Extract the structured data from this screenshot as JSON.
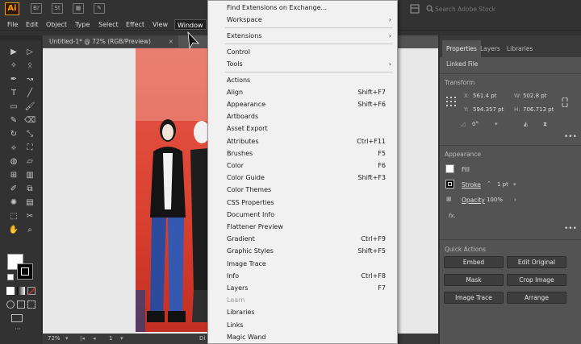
{
  "app": {
    "logo": "Ai",
    "icons": [
      {
        "name": "bridge-icon",
        "text": "Br"
      },
      {
        "name": "stock-icon",
        "text": "St"
      },
      {
        "name": "workspace-grid-icon",
        "text": "▦"
      },
      {
        "name": "brush-arrange-icon",
        "text": "✎"
      }
    ],
    "search_placeholder": "Search Adobe Stock"
  },
  "menubar": {
    "items": [
      "File",
      "Edit",
      "Object",
      "Type",
      "Select",
      "Effect",
      "View",
      "Window"
    ]
  },
  "document": {
    "tab_title": "Untitled-1* @ 72% (RGB/Preview)",
    "zoom": "72%",
    "page": "1",
    "status_text": "Di"
  },
  "window_menu": {
    "items": [
      {
        "label": "Find Extensions on Exchange...",
        "shortcut": "",
        "submenu": false,
        "disabled": false
      },
      {
        "label": "Workspace",
        "shortcut": "",
        "submenu": true,
        "disabled": false,
        "sep_after": true
      },
      {
        "label": "Extensions",
        "shortcut": "",
        "submenu": true,
        "disabled": false,
        "sep_after": true
      },
      {
        "label": "Control",
        "shortcut": "",
        "submenu": false,
        "disabled": false
      },
      {
        "label": "Tools",
        "shortcut": "",
        "submenu": true,
        "disabled": false,
        "sep_after": true
      },
      {
        "label": "Actions",
        "shortcut": "",
        "submenu": false,
        "disabled": false
      },
      {
        "label": "Align",
        "shortcut": "Shift+F7",
        "submenu": false,
        "disabled": false
      },
      {
        "label": "Appearance",
        "shortcut": "Shift+F6",
        "submenu": false,
        "disabled": false
      },
      {
        "label": "Artboards",
        "shortcut": "",
        "submenu": false,
        "disabled": false
      },
      {
        "label": "Asset Export",
        "shortcut": "",
        "submenu": false,
        "disabled": false
      },
      {
        "label": "Attributes",
        "shortcut": "Ctrl+F11",
        "submenu": false,
        "disabled": false
      },
      {
        "label": "Brushes",
        "shortcut": "F5",
        "submenu": false,
        "disabled": false
      },
      {
        "label": "Color",
        "shortcut": "F6",
        "submenu": false,
        "disabled": false
      },
      {
        "label": "Color Guide",
        "shortcut": "Shift+F3",
        "submenu": false,
        "disabled": false
      },
      {
        "label": "Color Themes",
        "shortcut": "",
        "submenu": false,
        "disabled": false
      },
      {
        "label": "CSS Properties",
        "shortcut": "",
        "submenu": false,
        "disabled": false
      },
      {
        "label": "Document Info",
        "shortcut": "",
        "submenu": false,
        "disabled": false
      },
      {
        "label": "Flattener Preview",
        "shortcut": "",
        "submenu": false,
        "disabled": false
      },
      {
        "label": "Gradient",
        "shortcut": "Ctrl+F9",
        "submenu": false,
        "disabled": false
      },
      {
        "label": "Graphic Styles",
        "shortcut": "Shift+F5",
        "submenu": false,
        "disabled": false
      },
      {
        "label": "Image Trace",
        "shortcut": "",
        "submenu": false,
        "disabled": false
      },
      {
        "label": "Info",
        "shortcut": "Ctrl+F8",
        "submenu": false,
        "disabled": false
      },
      {
        "label": "Layers",
        "shortcut": "F7",
        "submenu": false,
        "disabled": false
      },
      {
        "label": "Learn",
        "shortcut": "",
        "submenu": false,
        "disabled": true
      },
      {
        "label": "Libraries",
        "shortcut": "",
        "submenu": false,
        "disabled": false
      },
      {
        "label": "Links",
        "shortcut": "",
        "submenu": false,
        "disabled": false
      },
      {
        "label": "Magic Wand",
        "shortcut": "",
        "submenu": false,
        "disabled": false
      }
    ]
  },
  "panel": {
    "tabs": [
      "Properties",
      "Layers",
      "Libraries"
    ],
    "linked_file": "Linked File",
    "transform": {
      "title": "Transform",
      "x_label": "X:",
      "x": "561.4 pt",
      "y_label": "Y:",
      "y": "594.357 pt",
      "w_label": "W:",
      "w": "502.8 pt",
      "h_label": "H:",
      "h": "706.713 pt",
      "angle": "0°"
    },
    "appearance": {
      "title": "Appearance",
      "fill": "Fill",
      "stroke": "Stroke",
      "stroke_value": "1 pt",
      "opacity": "Opacity",
      "opacity_value": "100%",
      "fx": "fx."
    },
    "quick_actions": {
      "title": "Quick Actions",
      "buttons": [
        "Embed",
        "Edit Original",
        "Mask",
        "Crop Image",
        "Image Trace",
        "Arrange"
      ]
    },
    "colors": {
      "panel_bg": "#535353",
      "fill_swatch": "#ffffff",
      "stroke_swatch": "#000000"
    }
  },
  "toolbar": {
    "tools": [
      "selection-tool",
      "direct-selection-tool",
      "magic-wand-tool",
      "lasso-tool",
      "pen-tool",
      "curvature-tool",
      "type-tool",
      "line-tool",
      "rectangle-tool",
      "paintbrush-tool",
      "shaper-tool",
      "eraser-tool",
      "rotate-tool",
      "scale-tool",
      "width-tool",
      "free-transform-tool",
      "shape-builder-tool",
      "perspective-tool",
      "mesh-tool",
      "gradient-tool",
      "eyedropper-tool",
      "blend-tool",
      "symbol-sprayer-tool",
      "graph-tool",
      "artboard-tool",
      "slice-tool",
      "hand-tool",
      "zoom-tool"
    ]
  }
}
